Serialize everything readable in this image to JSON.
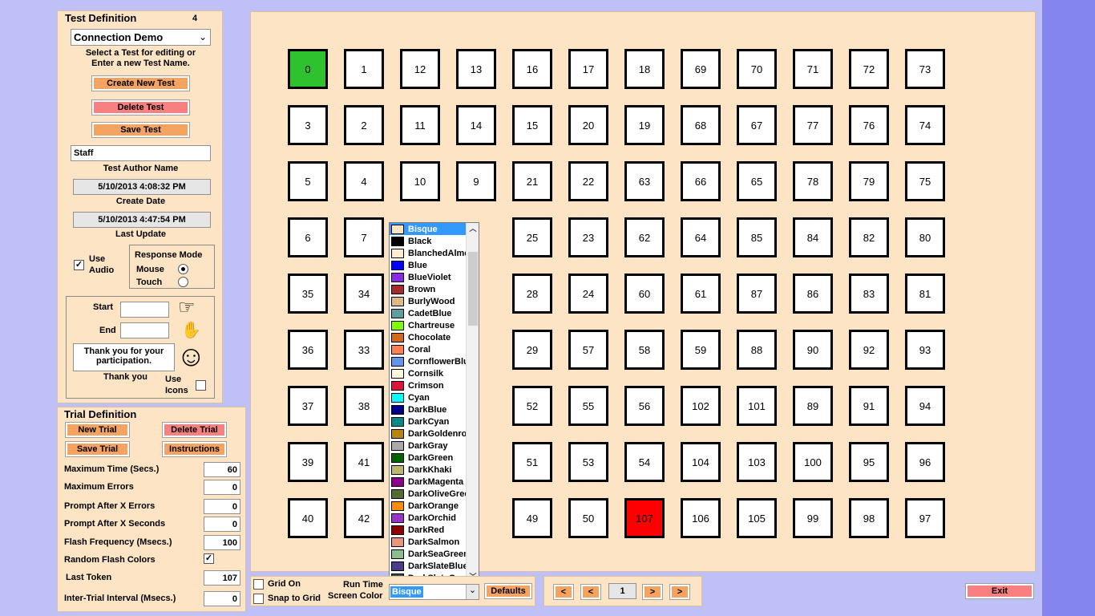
{
  "test_def": {
    "title": "Test Definition",
    "count": "4",
    "test_name": "Connection Demo",
    "hint_line1": "Select a Test for editing or",
    "hint_line2": "Enter a new Test Name.",
    "create_label": "Create New Test",
    "delete_label": "Delete Test",
    "save_label": "Save Test",
    "author_value": "Staff",
    "author_label": "Test Author Name",
    "create_date_value": "5/10/2013 4:08:32 PM",
    "create_date_label": "Create Date",
    "update_value": "5/10/2013 4:47:54 PM",
    "update_label": "Last Update",
    "use_audio_line1": "Use",
    "use_audio_line2": "Audio",
    "use_audio_checked": "✓",
    "response_mode_label": "Response Mode",
    "mouse_label": "Mouse",
    "touch_label": "Touch",
    "start_label": "Start",
    "end_label": "End",
    "start_value": "",
    "end_value": "",
    "thanks_line1": "Thank you for your",
    "thanks_line2": "participation.",
    "thanks_label": "Thank you",
    "use_icons_line1": "Use",
    "use_icons_line2": "Icons",
    "pointer_icon": "☞",
    "hand_icon": "✋",
    "smiley_icon": "☺"
  },
  "trial_def": {
    "title": "Trial Definition",
    "new_label": "New Trial",
    "delete_label": "Delete Trial",
    "save_label": "Save Trial",
    "instructions_label": "Instructions",
    "rows": [
      {
        "label": "Maximum Time (Secs.)",
        "value": "60"
      },
      {
        "label": "Maximum Errors",
        "value": "0"
      },
      {
        "label": "Prompt After X Errors",
        "value": "0"
      },
      {
        "label": "Prompt After X Seconds",
        "value": "0"
      },
      {
        "label": "Flash Frequency (Msecs.)",
        "value": "100"
      },
      {
        "label": "Random Flash Colors",
        "value": "✓"
      },
      {
        "label": "Last Token",
        "value": "107"
      },
      {
        "label": "Inter-Trial Interval (Msecs.)",
        "value": "0"
      }
    ]
  },
  "grid": {
    "background": "#fce4c4",
    "rows": [
      [
        "0",
        "1",
        "12",
        "13",
        "16",
        "17",
        "18",
        "69",
        "70",
        "71",
        "72",
        "73"
      ],
      [
        "3",
        "2",
        "11",
        "14",
        "15",
        "20",
        "19",
        "68",
        "67",
        "77",
        "76",
        "74"
      ],
      [
        "5",
        "4",
        "10",
        "9",
        "21",
        "22",
        "63",
        "66",
        "65",
        "78",
        "79",
        "75"
      ],
      [
        "6",
        "7",
        "",
        "",
        "25",
        "23",
        "62",
        "64",
        "85",
        "84",
        "82",
        "80"
      ],
      [
        "35",
        "34",
        "",
        "",
        "28",
        "24",
        "60",
        "61",
        "87",
        "86",
        "83",
        "81"
      ],
      [
        "36",
        "33",
        "",
        "",
        "29",
        "57",
        "58",
        "59",
        "88",
        "90",
        "92",
        "93"
      ],
      [
        "37",
        "38",
        "",
        "",
        "52",
        "55",
        "56",
        "102",
        "101",
        "89",
        "91",
        "94"
      ],
      [
        "39",
        "41",
        "",
        "",
        "51",
        "53",
        "54",
        "104",
        "103",
        "100",
        "95",
        "96"
      ],
      [
        "40",
        "42",
        "",
        "",
        "49",
        "50",
        "107",
        "106",
        "105",
        "99",
        "98",
        "97"
      ]
    ],
    "green_token": "0",
    "red_token": "107"
  },
  "color_list": {
    "items": [
      {
        "name": "Bisque",
        "color": "#ffe4c4"
      },
      {
        "name": "Black",
        "color": "#000000"
      },
      {
        "name": "BlanchedAlmond",
        "color": "#ffebcd"
      },
      {
        "name": "Blue",
        "color": "#0000ff"
      },
      {
        "name": "BlueViolet",
        "color": "#8a2be2"
      },
      {
        "name": "Brown",
        "color": "#a52a2a"
      },
      {
        "name": "BurlyWood",
        "color": "#deb887"
      },
      {
        "name": "CadetBlue",
        "color": "#5f9ea0"
      },
      {
        "name": "Chartreuse",
        "color": "#7fff00"
      },
      {
        "name": "Chocolate",
        "color": "#d2691e"
      },
      {
        "name": "Coral",
        "color": "#ff7f50"
      },
      {
        "name": "CornflowerBlue",
        "color": "#6495ed"
      },
      {
        "name": "Cornsilk",
        "color": "#fff8dc"
      },
      {
        "name": "Crimson",
        "color": "#dc143c"
      },
      {
        "name": "Cyan",
        "color": "#00ffff"
      },
      {
        "name": "DarkBlue",
        "color": "#00008b"
      },
      {
        "name": "DarkCyan",
        "color": "#008b8b"
      },
      {
        "name": "DarkGoldenrod",
        "color": "#b8860b"
      },
      {
        "name": "DarkGray",
        "color": "#a9a9a9"
      },
      {
        "name": "DarkGreen",
        "color": "#006400"
      },
      {
        "name": "DarkKhaki",
        "color": "#bdb76b"
      },
      {
        "name": "DarkMagenta",
        "color": "#8b008b"
      },
      {
        "name": "DarkOliveGreen",
        "color": "#556b2f"
      },
      {
        "name": "DarkOrange",
        "color": "#ff8c00"
      },
      {
        "name": "DarkOrchid",
        "color": "#9932cc"
      },
      {
        "name": "DarkRed",
        "color": "#8b0000"
      },
      {
        "name": "DarkSalmon",
        "color": "#e9967a"
      },
      {
        "name": "DarkSeaGreen",
        "color": "#8fbc8f"
      },
      {
        "name": "DarkSlateBlue",
        "color": "#483d8b"
      },
      {
        "name": "DarkSlateGray",
        "color": "#2f4f4f"
      }
    ]
  },
  "bottom": {
    "grid_on_label": "Grid On",
    "snap_label": "Snap to Grid",
    "run_time_label": "Run Time",
    "screen_color_label": "Screen Color",
    "screen_color_value": "Bisque",
    "defaults_label": "Defaults",
    "nav_first": "<",
    "nav_prev": "<",
    "page_value": "1",
    "nav_next": ">",
    "nav_last": ">",
    "exit_label": "Exit"
  }
}
